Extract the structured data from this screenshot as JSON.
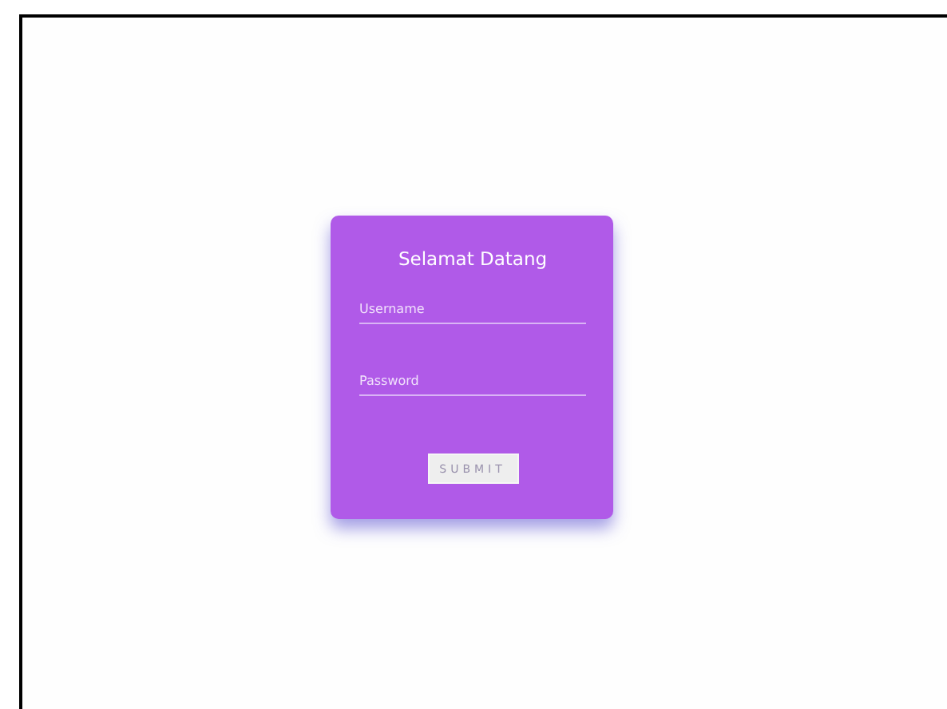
{
  "card": {
    "title": "Selamat Datang",
    "fields": [
      {
        "placeholder": "Username"
      },
      {
        "placeholder": "Password"
      }
    ],
    "button": "SUBMIT"
  }
}
